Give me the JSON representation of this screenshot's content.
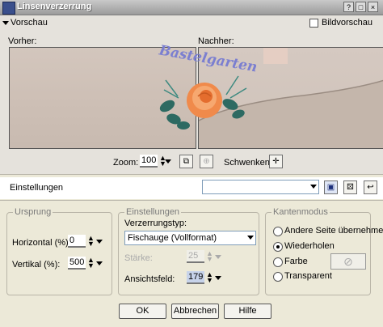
{
  "window": {
    "title": "Linsenverzerrung"
  },
  "preview_section": {
    "header": "Vorschau",
    "bildvorschau_label": "Bildvorschau",
    "before_label": "Vorher:",
    "after_label": "Nachher:",
    "watermark_text": "Bastelgarten",
    "zoom_label": "Zoom:",
    "zoom_value": "100",
    "pan_label": "Schwenken:"
  },
  "settings_bar": {
    "label": "Einstellungen",
    "preset_value": ""
  },
  "ursprung": {
    "legend": "Ursprung",
    "horizontal_label": "Horizontal (%):",
    "horizontal_value": "0",
    "vertical_label": "Vertikal (%):",
    "vertical_value": "500"
  },
  "einstellungen": {
    "legend": "Einstellungen",
    "type_label": "Verzerrungstyp:",
    "type_value": "Fischauge (Vollformat)",
    "strength_label": "Stärke:",
    "strength_value": "25",
    "fov_label": "Ansichtsfeld:",
    "fov_value": "179"
  },
  "kantenmodus": {
    "legend": "Kantenmodus",
    "options": [
      "Andere Seite übernehmen",
      "Wiederholen",
      "Farbe",
      "Transparent"
    ],
    "selected": "Wiederholen"
  },
  "buttons": {
    "ok": "OK",
    "cancel": "Abbrechen",
    "help": "Hilfe"
  }
}
